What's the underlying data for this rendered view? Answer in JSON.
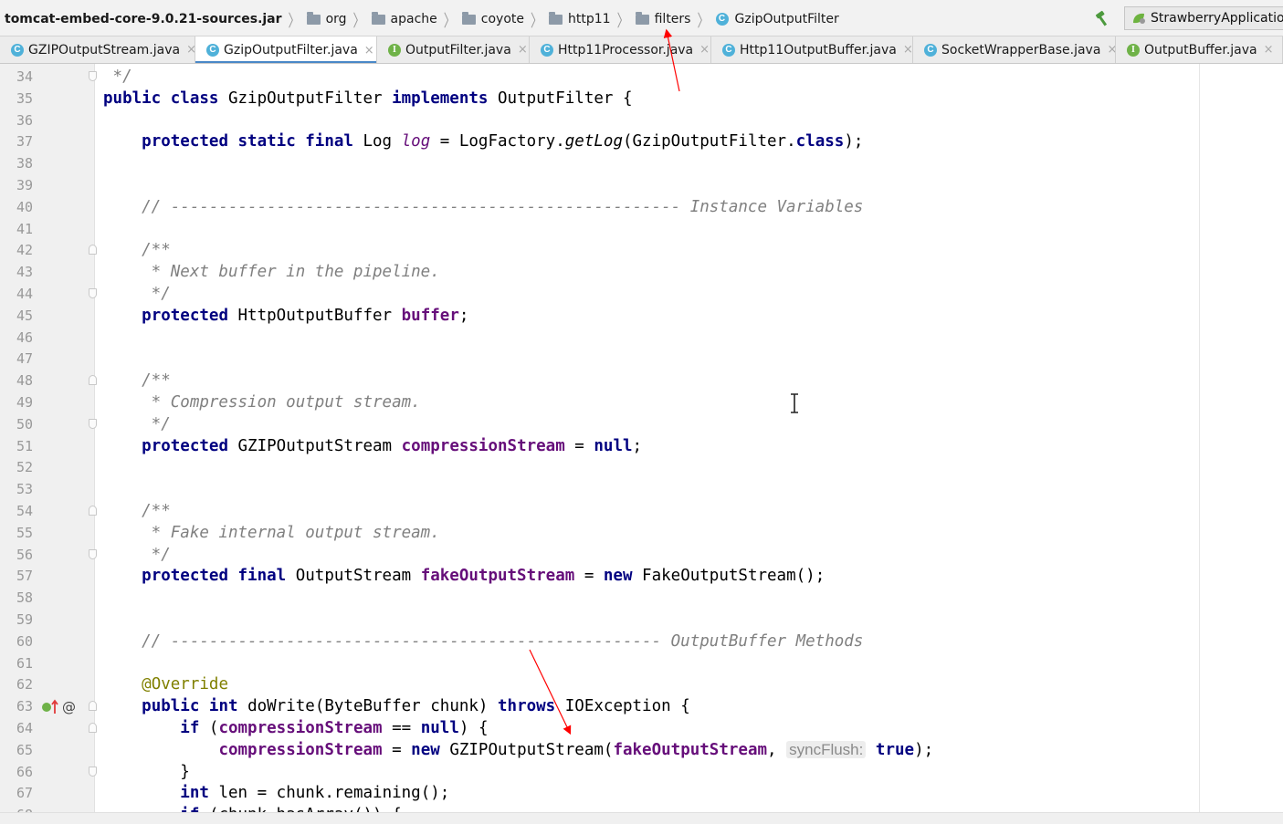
{
  "breadcrumb": [
    {
      "label": "tomcat-embed-core-9.0.21-sources.jar",
      "icon": "none"
    },
    {
      "label": "org",
      "icon": "folder-icon"
    },
    {
      "label": "apache",
      "icon": "folder-icon"
    },
    {
      "label": "coyote",
      "icon": "folder-icon"
    },
    {
      "label": "http11",
      "icon": "folder-icon"
    },
    {
      "label": "filters",
      "icon": "folder-icon"
    },
    {
      "label": "GzipOutputFilter",
      "icon": "class-icon"
    }
  ],
  "class_icon_letter": "C",
  "interface_icon_letter": "I",
  "run_config": {
    "label": "StrawberryApplication"
  },
  "tab_close_glyph": "×",
  "tabs": [
    {
      "label": "GZIPOutputStream.java",
      "kind": "class",
      "active": false
    },
    {
      "label": "GzipOutputFilter.java",
      "kind": "class",
      "active": true
    },
    {
      "label": "OutputFilter.java",
      "kind": "interface",
      "active": false
    },
    {
      "label": "Http11Processor.java",
      "kind": "class",
      "active": false
    },
    {
      "label": "Http11OutputBuffer.java",
      "kind": "class",
      "active": false
    },
    {
      "label": "SocketWrapperBase.java",
      "kind": "class",
      "active": false
    },
    {
      "label": "OutputBuffer.java",
      "kind": "interface",
      "active": false
    }
  ],
  "gutter": {
    "override_marker": "@"
  },
  "colors": {
    "keyword": "#000080",
    "field": "#660e7a",
    "comment": "#808080",
    "annotation": "#808000",
    "annotation_arrow": "#ff0000",
    "active_tab_underline": "#4a88c7"
  },
  "code_lines": [
    {
      "n": "34",
      "fold": "down",
      "tokens": [
        [
          " */",
          "cm"
        ]
      ]
    },
    {
      "n": "35",
      "tokens": [
        [
          "public class ",
          "kw"
        ],
        [
          "GzipOutputFilter ",
          ""
        ],
        [
          "implements ",
          "kw"
        ],
        [
          "OutputFilter {",
          ""
        ]
      ]
    },
    {
      "n": "36",
      "tokens": []
    },
    {
      "n": "37",
      "tokens": [
        [
          "    ",
          ""
        ],
        [
          "protected static final ",
          "kw"
        ],
        [
          "Log ",
          ""
        ],
        [
          "log",
          "sfi"
        ],
        [
          " = LogFactory.",
          ""
        ],
        [
          "getLog",
          "meth"
        ],
        [
          "(GzipOutputFilter.",
          ""
        ],
        [
          "class",
          "kw"
        ],
        [
          ");",
          ""
        ]
      ]
    },
    {
      "n": "38",
      "tokens": []
    },
    {
      "n": "39",
      "tokens": []
    },
    {
      "n": "40",
      "tokens": [
        [
          "    // ----------------------------------------------------- Instance Variables",
          "cm"
        ]
      ]
    },
    {
      "n": "41",
      "tokens": []
    },
    {
      "n": "42",
      "fold": "up",
      "tokens": [
        [
          "    /**",
          "cm"
        ]
      ]
    },
    {
      "n": "43",
      "tokens": [
        [
          "     * Next buffer in the pipeline.",
          "cm"
        ]
      ]
    },
    {
      "n": "44",
      "fold": "down",
      "tokens": [
        [
          "     */",
          "cm"
        ]
      ]
    },
    {
      "n": "45",
      "tokens": [
        [
          "    ",
          ""
        ],
        [
          "protected ",
          "kw"
        ],
        [
          "HttpOutputBuffer ",
          ""
        ],
        [
          "buffer",
          "fld"
        ],
        [
          ";",
          ""
        ]
      ]
    },
    {
      "n": "46",
      "tokens": []
    },
    {
      "n": "47",
      "tokens": []
    },
    {
      "n": "48",
      "fold": "up",
      "tokens": [
        [
          "    /**",
          "cm"
        ]
      ]
    },
    {
      "n": "49",
      "tokens": [
        [
          "     * Compression output stream.",
          "cm"
        ]
      ]
    },
    {
      "n": "50",
      "fold": "down",
      "tokens": [
        [
          "     */",
          "cm"
        ]
      ]
    },
    {
      "n": "51",
      "tokens": [
        [
          "    ",
          ""
        ],
        [
          "protected ",
          "kw"
        ],
        [
          "GZIPOutputStream ",
          ""
        ],
        [
          "compressionStream",
          "fld"
        ],
        [
          " = ",
          ""
        ],
        [
          "null",
          "kw"
        ],
        [
          ";",
          ""
        ]
      ]
    },
    {
      "n": "52",
      "tokens": []
    },
    {
      "n": "53",
      "tokens": []
    },
    {
      "n": "54",
      "fold": "up",
      "tokens": [
        [
          "    /**",
          "cm"
        ]
      ]
    },
    {
      "n": "55",
      "tokens": [
        [
          "     * Fake internal output stream.",
          "cm"
        ]
      ]
    },
    {
      "n": "56",
      "fold": "down",
      "tokens": [
        [
          "     */",
          "cm"
        ]
      ]
    },
    {
      "n": "57",
      "tokens": [
        [
          "    ",
          ""
        ],
        [
          "protected final ",
          "kw"
        ],
        [
          "OutputStream ",
          ""
        ],
        [
          "fakeOutputStream",
          "fld"
        ],
        [
          " = ",
          ""
        ],
        [
          "new ",
          "kw"
        ],
        [
          "FakeOutputStream();",
          ""
        ]
      ]
    },
    {
      "n": "58",
      "tokens": []
    },
    {
      "n": "59",
      "tokens": []
    },
    {
      "n": "60",
      "tokens": [
        [
          "    // --------------------------------------------------- OutputBuffer Methods",
          "cm"
        ]
      ]
    },
    {
      "n": "61",
      "tokens": []
    },
    {
      "n": "62",
      "tokens": [
        [
          "    ",
          ""
        ],
        [
          "@Override",
          "ann"
        ]
      ]
    },
    {
      "n": "63",
      "fold": "up",
      "gicons": true,
      "tokens": [
        [
          "    ",
          ""
        ],
        [
          "public int ",
          "kw"
        ],
        [
          "doWrite(ByteBuffer chunk) ",
          ""
        ],
        [
          "throws ",
          "kw"
        ],
        [
          "IOException {",
          ""
        ]
      ]
    },
    {
      "n": "64",
      "fold": "up",
      "tokens": [
        [
          "        ",
          ""
        ],
        [
          "if ",
          "kw"
        ],
        [
          "(",
          ""
        ],
        [
          "compressionStream",
          "fld"
        ],
        [
          " == ",
          ""
        ],
        [
          "null",
          "kw"
        ],
        [
          ") {",
          ""
        ]
      ]
    },
    {
      "n": "65",
      "tokens": [
        [
          "            ",
          ""
        ],
        [
          "compressionStream",
          "fld"
        ],
        [
          " = ",
          ""
        ],
        [
          "new ",
          "kw"
        ],
        [
          "GZIPOutputStream(",
          ""
        ],
        [
          "fakeOutputStream",
          "fld"
        ],
        [
          ", ",
          ""
        ],
        [
          "syncFlush:",
          "hint"
        ],
        [
          " ",
          ""
        ],
        [
          "true",
          "kw"
        ],
        [
          ");",
          ""
        ]
      ]
    },
    {
      "n": "66",
      "fold": "down",
      "tokens": [
        [
          "        }",
          ""
        ]
      ]
    },
    {
      "n": "67",
      "tokens": [
        [
          "        ",
          ""
        ],
        [
          "int ",
          "kw"
        ],
        [
          "len = chunk.remaining();",
          ""
        ]
      ]
    },
    {
      "n": "68",
      "tokens": [
        [
          "        ",
          ""
        ],
        [
          "if ",
          "kw"
        ],
        [
          "(chunk.hasArray()) {",
          ""
        ]
      ]
    }
  ]
}
